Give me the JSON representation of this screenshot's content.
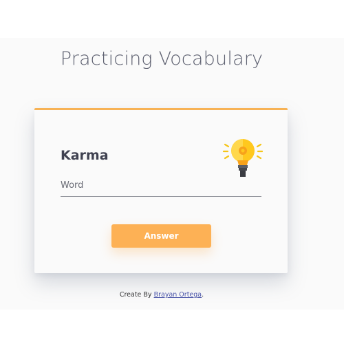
{
  "header": {
    "title": "Practicing Vocabulary"
  },
  "card": {
    "word": "Karma",
    "input_placeholder": "Word",
    "input_value": "",
    "answer_label": "Answer",
    "icon": "lightbulb-icon"
  },
  "footer": {
    "prefix": "Create By ",
    "author_link": "Brayan Ortega",
    "suffix": "."
  },
  "colors": {
    "accent": "#fdb155",
    "card_border": "#f7b255",
    "title": "#5b5e6e",
    "word": "#3f4150"
  }
}
